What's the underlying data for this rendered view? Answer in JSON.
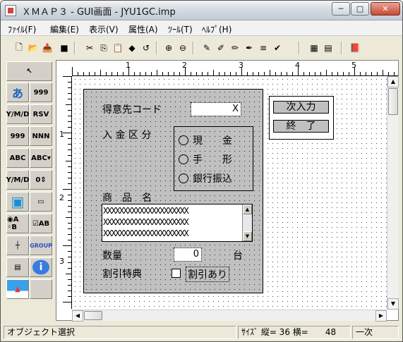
{
  "window": {
    "title": "ＸＭＡＰ３ - GUI画面 - JYU1GC.imp",
    "min": "─",
    "max": "□",
    "close": "✕"
  },
  "menu": [
    "ﾌｧｲﾙ(F)",
    "編集(E)",
    "表示(V)",
    "属性(A)",
    "ﾂｰﾙ(T)",
    "ﾍﾙﾌﾟ(H)"
  ],
  "toolbar": [
    {
      "name": "new-icon",
      "glyph": "🗋"
    },
    {
      "name": "open-icon",
      "glyph": "📂"
    },
    {
      "name": "import-icon",
      "glyph": "📥"
    },
    {
      "name": "exit-icon",
      "glyph": "■"
    },
    {
      "name": "cut-icon",
      "glyph": "✂"
    },
    {
      "name": "copy-icon",
      "glyph": "⎘"
    },
    {
      "name": "paste-icon",
      "glyph": "📋"
    },
    {
      "name": "erase-icon",
      "glyph": "◆"
    },
    {
      "name": "undo-icon",
      "glyph": "↺"
    },
    {
      "name": "zoom-in-icon",
      "glyph": "⊕"
    },
    {
      "name": "zoom-out-icon",
      "glyph": "⊖"
    },
    {
      "name": "pencil-icon",
      "glyph": "✎"
    },
    {
      "name": "edit-icon",
      "glyph": "✐"
    },
    {
      "name": "multi-pencil-icon",
      "glyph": "✏"
    },
    {
      "name": "script-icon",
      "glyph": "✒"
    },
    {
      "name": "list-icon",
      "glyph": "≡"
    },
    {
      "name": "check-icon",
      "glyph": "✔"
    },
    {
      "name": "layout-icon",
      "glyph": "▦"
    },
    {
      "name": "order-icon",
      "glyph": "▤"
    },
    {
      "name": "book-icon",
      "glyph": "📕"
    }
  ],
  "palette": [
    {
      "name": "pointer-tool",
      "t": "↖"
    },
    {
      "name": "text-label-tool",
      "t": "あ"
    },
    {
      "name": "numeric-tool",
      "t": "999"
    },
    {
      "name": "date-tool",
      "t": "Y/M/D"
    },
    {
      "name": "rsv-tool",
      "t": "RSV"
    },
    {
      "name": "numeric-field-tool",
      "t": "999"
    },
    {
      "name": "alnum-field-tool",
      "t": "NNN"
    },
    {
      "name": "abc-field-tool",
      "t": "ABC"
    },
    {
      "name": "abc-combo-tool",
      "t": "ABC▾"
    },
    {
      "name": "date-field-tool",
      "t": "Y/M/D"
    },
    {
      "name": "spin-tool",
      "t": "0⇕"
    },
    {
      "name": "screen-tool",
      "t": "▣"
    },
    {
      "name": "button-tool",
      "t": "▭"
    },
    {
      "name": "radio-tool",
      "t": "◉A ◦B"
    },
    {
      "name": "checkbox-tool",
      "t": "☑AB"
    },
    {
      "name": "line-tool",
      "t": "┼"
    },
    {
      "name": "group-tool",
      "t": "GROUP"
    },
    {
      "name": "grid-tool",
      "t": "▤"
    },
    {
      "name": "info-tool",
      "t": "i"
    },
    {
      "name": "image-tool",
      "t": "▲"
    },
    {
      "name": "blank-tool",
      "t": ""
    }
  ],
  "ruler": {
    "h": [
      "1",
      "2",
      "3",
      "4",
      "5"
    ],
    "v": [
      "1",
      "2",
      "3"
    ]
  },
  "form": {
    "customer_code_label": "得意先コード",
    "customer_code_value": "X",
    "payment_label": "入 金 区 分",
    "payment_options": [
      "現　　金",
      "手　　形",
      "銀行振込"
    ],
    "product_label": "商　品　名",
    "product_rows": [
      "XXXXXXXXXXXXXXXXXXXXX",
      "XXXXXXXXXXXXXXXXXXXXX",
      "XXXXXXXXXXXXXXXXXXXXX"
    ],
    "qty_label": "数量",
    "qty_value": "0",
    "qty_unit": "台",
    "discount_label": "割引特典",
    "discount_check_label": "割引あり",
    "next_button": "次入力",
    "end_button": "終　了"
  },
  "status": {
    "message": "オブジェクト選択",
    "size": "ｻｲｽﾞ 縦= 36 横=　　48",
    "mode": "一次"
  }
}
